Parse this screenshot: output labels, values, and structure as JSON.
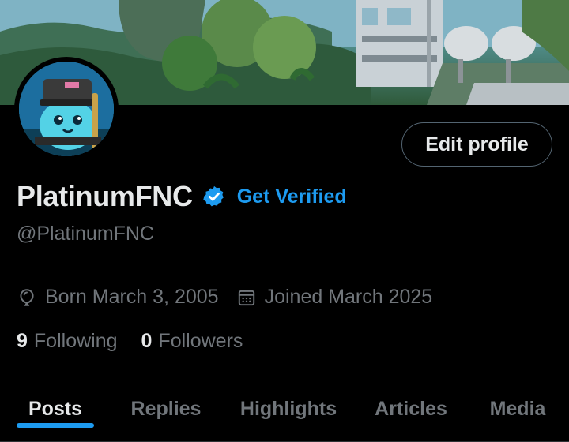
{
  "profile": {
    "display_name": "PlatinumFNC",
    "handle": "@PlatinumFNC",
    "get_verified_label": "Get Verified",
    "edit_profile_label": "Edit profile",
    "birth": "Born March 3, 2005",
    "joined": "Joined March 2025",
    "following_count": "9",
    "following_label": "Following",
    "followers_count": "0",
    "followers_label": "Followers"
  },
  "tabs": [
    {
      "label": "Posts",
      "active": true
    },
    {
      "label": "Replies",
      "active": false
    },
    {
      "label": "Highlights",
      "active": false
    },
    {
      "label": "Articles",
      "active": false
    },
    {
      "label": "Media",
      "active": false
    }
  ],
  "icons": {
    "verified": "verified-badge-icon",
    "birth": "balloon-icon",
    "joined": "calendar-icon"
  },
  "colors": {
    "accent": "#1d9bf0",
    "background": "#000000",
    "text_primary": "#e7e9ea",
    "text_secondary": "#71767b",
    "border": "#536471"
  }
}
